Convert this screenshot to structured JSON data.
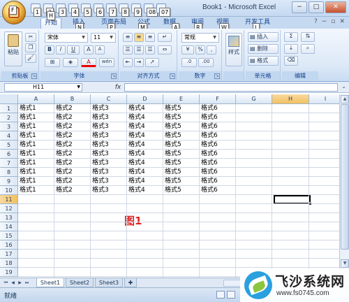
{
  "app": {
    "title": "Book1 - Microsoft Excel",
    "office_button_keytip": "F",
    "window_controls": [
      "−",
      "□",
      "✕"
    ]
  },
  "qat_keytips": [
    "1",
    "2",
    "3",
    "4",
    "5",
    "6",
    "7",
    "8",
    "9",
    "08",
    "07"
  ],
  "tabs": [
    {
      "label": "开始",
      "keytip": "H",
      "active": true
    },
    {
      "label": "插入",
      "keytip": "N"
    },
    {
      "label": "页面布局",
      "keytip": "P"
    },
    {
      "label": "公式",
      "keytip": "M"
    },
    {
      "label": "数据",
      "keytip": "A"
    },
    {
      "label": "审阅",
      "keytip": "R"
    },
    {
      "label": "视图",
      "keytip": "W"
    },
    {
      "label": "开发工具",
      "keytip": "L"
    }
  ],
  "ribbon": {
    "clipboard": {
      "paste_label": "粘贴",
      "group_label": "剪贴板"
    },
    "font": {
      "font_name": "宋体",
      "font_size": "11",
      "bold": "B",
      "italic": "I",
      "underline": "U",
      "grow": "A",
      "shrink": "A",
      "fill_color": "A",
      "wen": "wén",
      "group_label": "字体"
    },
    "alignment": {
      "group_label": "对齐方式"
    },
    "number": {
      "format": "常规",
      "percent": "%",
      "comma": ",",
      "group_label": "数字"
    },
    "styles": {
      "label": "样式"
    },
    "cells": {
      "insert": "插入",
      "delete": "删除",
      "format": "格式",
      "group_label": "单元格"
    },
    "editing": {
      "sum": "Σ",
      "group_label": "编辑"
    }
  },
  "formula_bar": {
    "name_box": "H11",
    "fx": "fx",
    "formula": ""
  },
  "columns": [
    "A",
    "B",
    "C",
    "D",
    "E",
    "F",
    "G",
    "H",
    "I"
  ],
  "selected_column": "H",
  "rows": [
    "1",
    "2",
    "3",
    "4",
    "5",
    "6",
    "7",
    "8",
    "9",
    "10",
    "11",
    "12",
    "13",
    "14",
    "15",
    "16",
    "17",
    "18",
    "19"
  ],
  "selected_row": "11",
  "cells": [
    [
      "格式1",
      "格式2",
      "格式3",
      "格式4",
      "格式5",
      "格式6"
    ],
    [
      "格式1",
      "格式2",
      "格式3",
      "格式4",
      "格式5",
      "格式6"
    ],
    [
      "格式1",
      "格式2",
      "格式3",
      "格式4",
      "格式5",
      "格式6"
    ],
    [
      "格式1",
      "格式2",
      "格式3",
      "格式4",
      "格式5",
      "格式6"
    ],
    [
      "格式1",
      "格式2",
      "格式3",
      "格式4",
      "格式5",
      "格式6"
    ],
    [
      "格式1",
      "格式2",
      "格式3",
      "格式4",
      "格式5",
      "格式6"
    ],
    [
      "格式1",
      "格式2",
      "格式3",
      "格式4",
      "格式5",
      "格式6"
    ],
    [
      "格式1",
      "格式2",
      "格式3",
      "格式4",
      "格式5",
      "格式6"
    ],
    [
      "格式1",
      "格式2",
      "格式3",
      "格式4",
      "格式5",
      "格式6"
    ],
    [
      "格式1",
      "格式2",
      "格式3",
      "格式4",
      "格式5",
      "格式6"
    ]
  ],
  "figure_label": "图1",
  "sheets": [
    "Sheet1",
    "Sheet2",
    "Sheet3"
  ],
  "active_sheet": "Sheet1",
  "status": "就绪",
  "watermark": {
    "title": "飞沙系统网",
    "url": "www.fs0745.com"
  }
}
